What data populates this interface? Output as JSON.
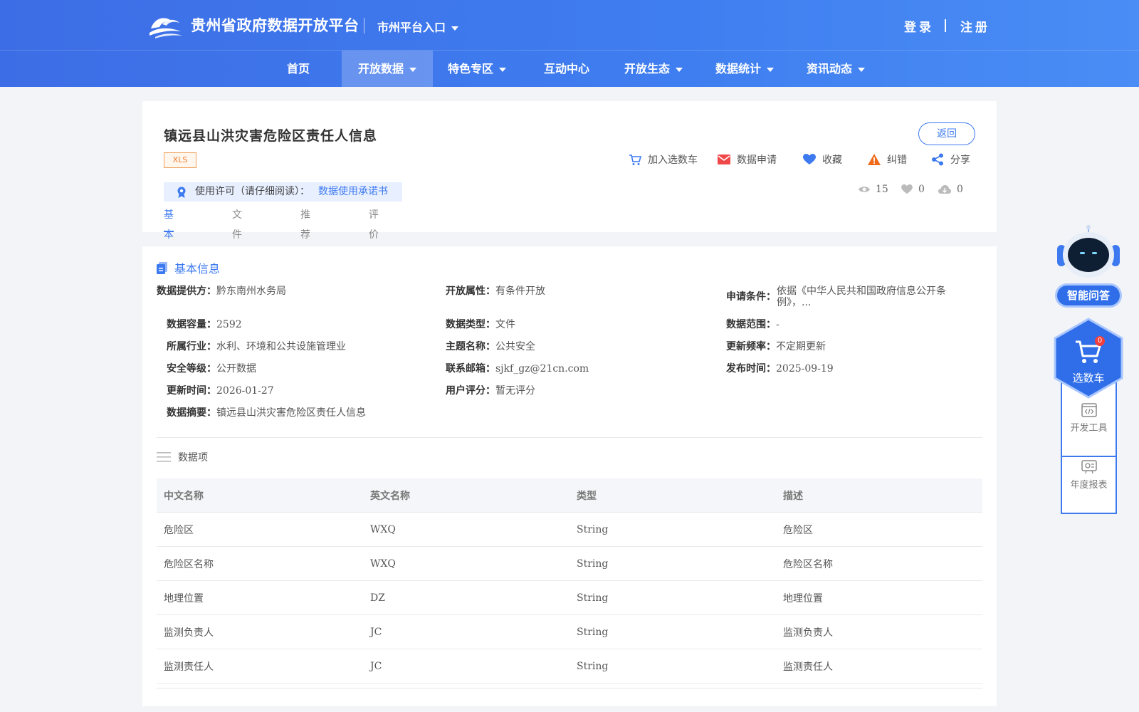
{
  "header": {
    "site_title": "贵州省政府数据开放平台",
    "city_entry": "市州平台入口",
    "login": "登录",
    "register": "注册"
  },
  "nav": {
    "items": [
      {
        "label": "首页"
      },
      {
        "label": "开放数据"
      },
      {
        "label": "特色专区"
      },
      {
        "label": "互动中心"
      },
      {
        "label": "开放生态"
      },
      {
        "label": "数据统计"
      },
      {
        "label": "资讯动态"
      }
    ],
    "active": "开放数据"
  },
  "dataset": {
    "title": "镇远县山洪灾害危险区责任人信息",
    "format": "XLS",
    "back_label": "返回",
    "actions": {
      "add_cart": "加入选数车",
      "apply": "数据申请",
      "favorite": "收藏",
      "report_error": "纠错",
      "share": "分享"
    },
    "license": {
      "label": "使用许可（请仔细阅读）：",
      "link": "数据使用承诺书"
    },
    "stats": {
      "views": "15",
      "likes": "0",
      "downloads": "0"
    },
    "tabs": [
      "基本信息",
      "文件数据",
      "推荐数据",
      "评价"
    ]
  },
  "basic_info": {
    "section_title": "基本信息",
    "fields": {
      "provider": {
        "k": "数据提供方：",
        "v": "黔东南州水务局"
      },
      "open_attr": {
        "k": "开放属性：",
        "v": "有条件开放"
      },
      "apply_cond": {
        "k": "申请条件：",
        "v": "依据《中华人民共和国政府信息公开条",
        "v2": "例》，..."
      },
      "capacity": {
        "k": "数据容量：",
        "v": "2592"
      },
      "data_type": {
        "k": "数据类型：",
        "v": "文件"
      },
      "data_range": {
        "k": "数据范围：",
        "v": "-"
      },
      "industry": {
        "k": "所属行业：",
        "v": "水利、环境和公共设施管理业"
      },
      "topic": {
        "k": "主题名称：",
        "v": "公共安全"
      },
      "update_freq": {
        "k": "更新频率：",
        "v": "不定期更新"
      },
      "security": {
        "k": "安全等级：",
        "v": "公开数据"
      },
      "email": {
        "k": "联系邮箱：",
        "v": "sjkf_gz@21cn.com"
      },
      "publish_time": {
        "k": "发布时间：",
        "v": "2025-09-19"
      },
      "update_time": {
        "k": "更新时间：",
        "v": "2026-01-27"
      },
      "rating": {
        "k": "用户评分：",
        "v": "暂无评分"
      },
      "summary": {
        "k": "数据摘要：",
        "v": "镇远县山洪灾害危险区责任人信息"
      }
    }
  },
  "data_items": {
    "title": "数据项",
    "columns": [
      "中文名称",
      "英文名称",
      "类型",
      "描述"
    ],
    "rows": [
      [
        "危险区",
        "WXQ",
        "String",
        "危险区"
      ],
      [
        "危险区名称",
        "WXQ",
        "String",
        "危险区名称"
      ],
      [
        "地理位置",
        "DZ",
        "String",
        "地理位置"
      ],
      [
        "监测负责人",
        "JC",
        "String",
        "监测负责人"
      ],
      [
        "监测责任人",
        "JC",
        "String",
        "监测责任人"
      ]
    ]
  },
  "side": {
    "ask": "智能问答",
    "cart": "选数车",
    "cart_count": "0",
    "dev_tools": "开发工具",
    "annual_report": "年度报表"
  },
  "colors": {
    "brand_blue": "#3d7af0",
    "header_gradient_start": "#3d6de6",
    "header_gradient_end": "#4a8df5",
    "tag_orange": "#f07d2a"
  }
}
